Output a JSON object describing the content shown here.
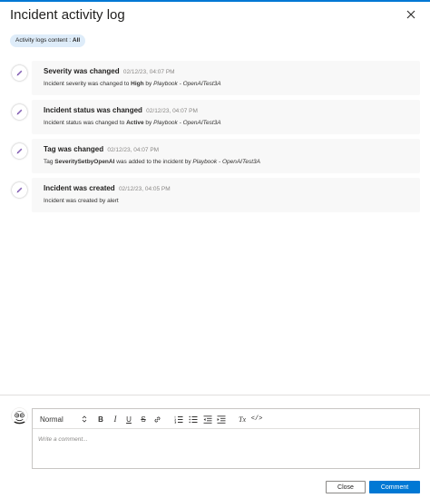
{
  "panel": {
    "title": "Incident activity log",
    "filter_label": "Activity logs content : ",
    "filter_value": "All"
  },
  "activities": [
    {
      "title": "Severity was changed",
      "time": "02/12/23, 04:07 PM",
      "desc_pre": "Incident severity was changed to ",
      "desc_bold": "High",
      "desc_mid": " by ",
      "desc_italic": "Playbook - OpenAITest3A",
      "desc_post": ""
    },
    {
      "title": "Incident status was changed",
      "time": "02/12/23, 04:07 PM",
      "desc_pre": "Incident status was changed to ",
      "desc_bold": "Active",
      "desc_mid": " by ",
      "desc_italic": "Playbook - OpenAITest3A",
      "desc_post": ""
    },
    {
      "title": "Tag was changed",
      "time": "02/12/23, 04:07 PM",
      "desc_pre": "Tag ",
      "desc_bold": "SeveritySetbyOpenAI",
      "desc_mid": " was added to the incident by ",
      "desc_italic": "Playbook - OpenAITest3A",
      "desc_post": ""
    },
    {
      "title": "Incident was created",
      "time": "02/12/23, 04:05 PM",
      "desc_pre": "Incident was created by alert",
      "desc_bold": "",
      "desc_mid": "",
      "desc_italic": "",
      "desc_post": ""
    }
  ],
  "editor": {
    "format_value": "Normal",
    "placeholder": "Write a comment...",
    "tools": {
      "bold": "B",
      "italic": "I",
      "underline": "U",
      "strike": "S",
      "clear_format": "Tx",
      "code": "</>"
    }
  },
  "buttons": {
    "close": "Close",
    "comment": "Comment"
  },
  "colors": {
    "accent": "#0078d4",
    "pencil": "#8764b8",
    "card_bg": "#f8f8f8"
  }
}
